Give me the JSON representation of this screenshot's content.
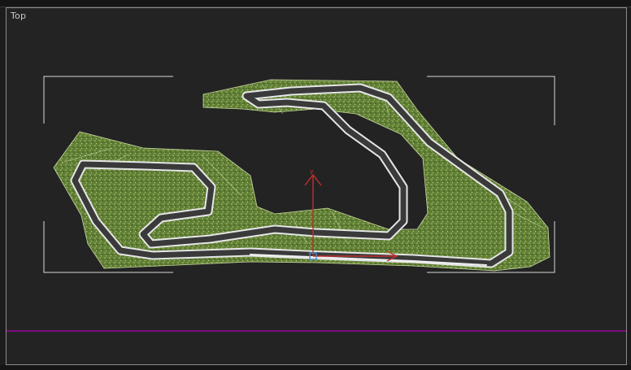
{
  "viewport": {
    "label": "Top",
    "colors": {
      "background": "#232323",
      "terrain": "#6a8a3c",
      "track_surface": "#3a3a3a",
      "track_edge": "#e6e6e6",
      "gizmo_axis": "#c03030",
      "grid_line": "#b000b0",
      "bounding_box": "#d8d8d8"
    },
    "objects": {
      "terrain": "grass-terrain",
      "track": "race-track",
      "gizmo": "transform-gizmo",
      "gizmo_axes": [
        "y",
        "x"
      ],
      "selection": "selection-bounding-box",
      "home_grid": "home-grid-line"
    }
  }
}
